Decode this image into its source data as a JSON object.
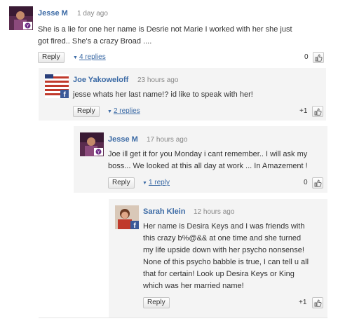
{
  "comments": [
    {
      "author": "Jesse M",
      "time": "1 day ago",
      "text_lines": [
        "She is a lie for one her name is Desrie not Marie I worked with her she just",
        "got fired.. She's a crazy Broad ...."
      ],
      "reply_label": "Reply",
      "replies_label": "4 replies",
      "likes": "0"
    },
    {
      "author": "Joe Yakoweloff",
      "time": "23 hours ago",
      "text_lines": [
        "jesse whats her last name!? id like to speak with her!"
      ],
      "reply_label": "Reply",
      "replies_label": "2 replies",
      "likes": "+1"
    },
    {
      "author": "Jesse M",
      "time": "17 hours ago",
      "text_lines": [
        "Joe ill get it for you Monday i cant remember.. I will ask my",
        "boss... We looked at this all day at work ... In Amazement !"
      ],
      "reply_label": "Reply",
      "replies_label": "1 reply",
      "likes": "0"
    },
    {
      "author": "Sarah Klein",
      "time": "12 hours ago",
      "text_lines": [
        "Her name is Desira Keys and I was friends with",
        "this crazy b%@&& at one time and she turned",
        "my life upside down with her psycho nonsense!",
        "None of this psycho babble is true, I can tell u all",
        "that for certain! Look up Desira Keys or King",
        "which was her married name!"
      ],
      "reply_label": "Reply",
      "likes": "+1"
    }
  ]
}
